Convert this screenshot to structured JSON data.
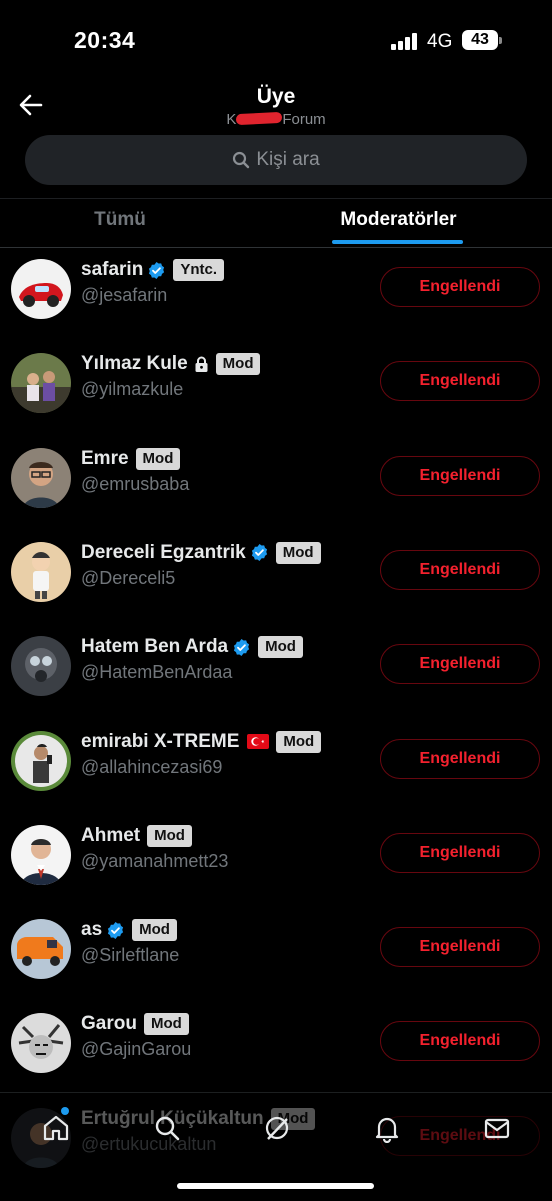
{
  "status_bar": {
    "time": "20:34",
    "network": "4G",
    "battery": "43"
  },
  "header": {
    "title": "Üye",
    "subtitle_visible": "Forum",
    "subtitle_prefix": "K"
  },
  "search": {
    "placeholder": "Kişi ara"
  },
  "tabs": [
    {
      "label": "Tümü",
      "active": false
    },
    {
      "label": "Moderatörler",
      "active": true
    }
  ],
  "colors": {
    "background": "#000000",
    "accent": "#1d9bf0",
    "danger": "#f4212e",
    "badge_bg": "#d9d9d9",
    "muted": "#71767b"
  },
  "members": [
    {
      "name": "safarin",
      "handle": "@jesafarin",
      "verified": true,
      "locked": false,
      "flag": false,
      "badge": "Yntc.",
      "action": "Engellendi",
      "avatar": "red-race-car"
    },
    {
      "name": "Yılmaz Kule",
      "handle": "@yilmazkule",
      "verified": false,
      "locked": true,
      "flag": false,
      "badge": "Mod",
      "action": "Engellendi",
      "avatar": "group-photo"
    },
    {
      "name": "Emre",
      "handle": "@emrusbaba",
      "verified": false,
      "locked": false,
      "flag": false,
      "badge": "Mod",
      "action": "Engellendi",
      "avatar": "man-with-glasses"
    },
    {
      "name": "Dereceli Egzantrik",
      "handle": "@Dereceli5",
      "verified": true,
      "locked": false,
      "flag": false,
      "badge": "Mod",
      "action": "Engellendi",
      "avatar": "cartoon-character"
    },
    {
      "name": "Hatem Ben Arda",
      "handle": "@HatemBenArdaa",
      "verified": true,
      "locked": false,
      "flag": false,
      "badge": "Mod",
      "action": "Engellendi",
      "avatar": "gas-mask"
    },
    {
      "name": "emirabi X-TREME",
      "handle": "@allahincezasi69",
      "verified": false,
      "locked": false,
      "flag": true,
      "badge": "Mod",
      "action": "Engellendi",
      "avatar": "mirror-selfie"
    },
    {
      "name": "Ahmet",
      "handle": "@yamanahmett23",
      "verified": false,
      "locked": false,
      "flag": false,
      "badge": "Mod",
      "action": "Engellendi",
      "avatar": "man-in-suit"
    },
    {
      "name": "as",
      "handle": "@Sirleftlane",
      "verified": true,
      "locked": false,
      "flag": false,
      "badge": "Mod",
      "action": "Engellendi",
      "avatar": "orange-van"
    },
    {
      "name": "Garou",
      "handle": "@GajinGarou",
      "verified": false,
      "locked": false,
      "flag": false,
      "badge": "Mod",
      "action": "Engellendi",
      "avatar": "anime-sketch"
    },
    {
      "name": "Ertuğrul Küçükaltun",
      "handle": "@ertukucukaltun",
      "verified": false,
      "locked": false,
      "flag": false,
      "badge": "Mod",
      "action": "Engellendi",
      "avatar": "portrait"
    }
  ],
  "bottom_nav": [
    {
      "icon": "home-icon",
      "has_notification_dot": true
    },
    {
      "icon": "search-icon"
    },
    {
      "icon": "grok-icon"
    },
    {
      "icon": "bell-icon"
    },
    {
      "icon": "mail-icon"
    }
  ]
}
